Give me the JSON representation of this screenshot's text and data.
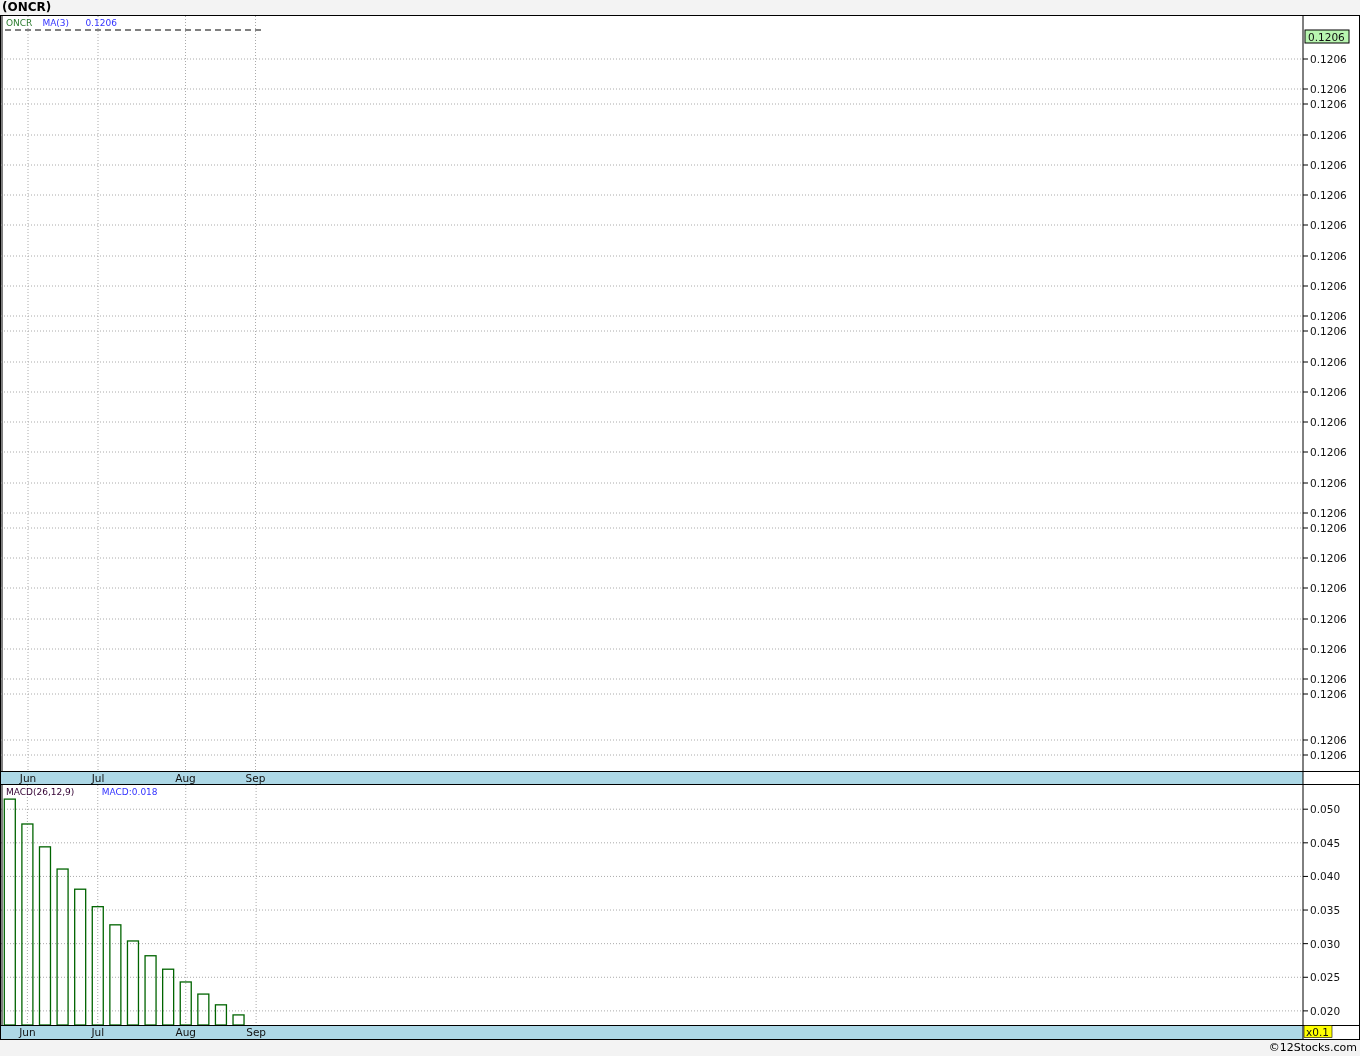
{
  "title": "(ONCR)",
  "price_pane": {
    "legend": [
      "ONCR",
      "MA(3)",
      "0.1206"
    ],
    "last_price_badge": "0.1206",
    "axis_labels": [
      "0.1206",
      "0.1206",
      "0.1206",
      "0.1206",
      "0.1206",
      "0.1206",
      "0.1206",
      "0.1206",
      "0.1206",
      "0.1206",
      "0.1206",
      "0.1206",
      "0.1206",
      "0.1206",
      "0.1206",
      "0.1206",
      "0.1206",
      "0.1206",
      "0.1206",
      "0.1206",
      "0.1206",
      "0.1206",
      "0.1206",
      "0.1206",
      "0.1206",
      "0.1206"
    ],
    "x_axis_labels": [
      "Jun",
      "Jul",
      "Aug",
      "Sep"
    ]
  },
  "macd_pane": {
    "reading": "MACD:0.018",
    "scale_badge": "x0.1",
    "chart_data": {
      "type": "bar",
      "title": "MACD(26,12,9)",
      "categories": [
        null,
        "Jun",
        null,
        null,
        null,
        "Jul",
        null,
        null,
        null,
        null,
        "Aug",
        null,
        null,
        null,
        "Sep",
        null,
        null,
        null,
        null,
        null,
        null,
        null,
        null,
        null,
        null,
        null,
        null,
        null,
        null,
        null,
        null,
        null,
        null,
        null,
        null,
        null,
        null,
        null,
        null,
        null,
        null,
        null,
        null,
        null,
        null,
        null,
        null,
        null,
        null,
        null,
        null,
        null,
        null,
        null,
        null,
        null,
        null,
        null,
        null,
        null,
        null,
        null,
        null,
        null,
        null,
        null,
        null,
        null,
        null,
        null,
        null,
        null,
        null,
        null
      ],
      "values": [
        0.0515,
        0.0478,
        0.0444,
        0.0411,
        0.0381,
        0.0355,
        0.0328,
        0.0304,
        0.0282,
        0.0262,
        0.0243,
        0.0225,
        0.0209,
        0.0194,
        null,
        null,
        null,
        null,
        null,
        null,
        null,
        null,
        null,
        null,
        null,
        null,
        null,
        null,
        null,
        null,
        null,
        null,
        null,
        null,
        null,
        null,
        null,
        null,
        null,
        null,
        null,
        null,
        null,
        null,
        null,
        null,
        null,
        null,
        null,
        null,
        null,
        null,
        null,
        null,
        null,
        null,
        null,
        null,
        null,
        null,
        null,
        null,
        null,
        null,
        null,
        null,
        null,
        null,
        null,
        null,
        null,
        null,
        null,
        null
      ],
      "ylim": [
        0.0179,
        0.0536
      ],
      "yticks": [
        {
          "value": 0.05,
          "label": "0.050"
        },
        {
          "value": 0.045,
          "label": "0.045"
        },
        {
          "value": 0.04,
          "label": "0.040"
        },
        {
          "value": 0.035,
          "label": "0.035"
        },
        {
          "value": 0.03,
          "label": "0.030"
        },
        {
          "value": 0.025,
          "label": "0.025"
        },
        {
          "value": 0.02,
          "label": "0.020"
        }
      ],
      "grid": true
    }
  },
  "footer": "©12Stocks.com"
}
